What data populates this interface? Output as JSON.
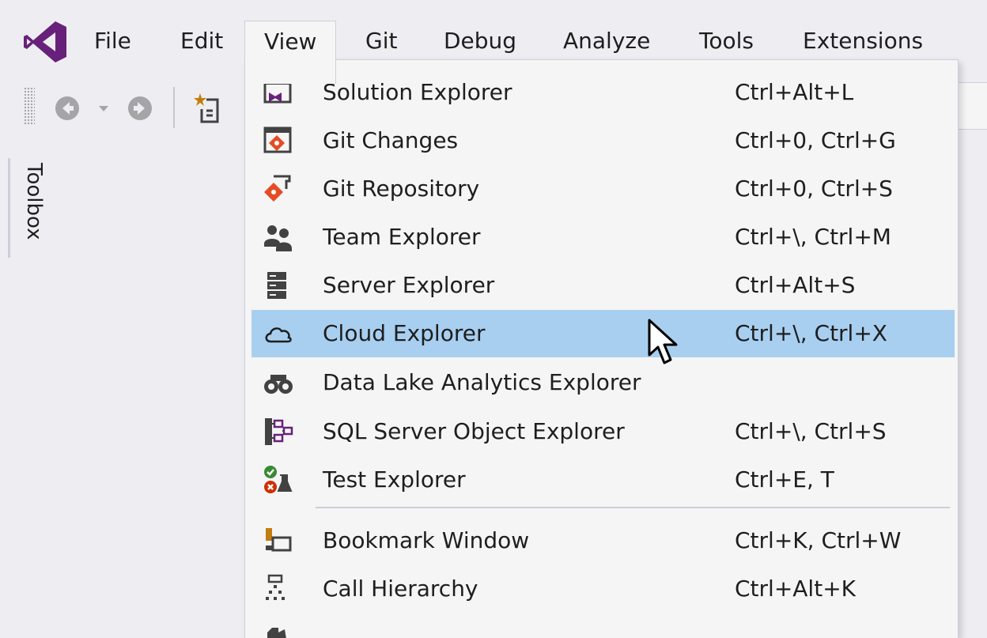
{
  "app": {
    "logo_icon": "visual-studio-logo-icon",
    "brand_color": "#68217a"
  },
  "menubar": {
    "items": [
      {
        "label": "File"
      },
      {
        "label": "Edit"
      },
      {
        "label": "View"
      },
      {
        "label": "Git"
      },
      {
        "label": "Debug"
      },
      {
        "label": "Analyze"
      },
      {
        "label": "Tools"
      },
      {
        "label": "Extensions"
      }
    ],
    "open_menu": "View"
  },
  "toolbar": {
    "icons": [
      "navigate-back-icon",
      "back-dropdown-icon",
      "navigate-forward-icon",
      "new-project-icon"
    ]
  },
  "toolbox": {
    "label": "Toolbox"
  },
  "view_menu": {
    "items": [
      {
        "label": "Solution Explorer",
        "shortcut": "Ctrl+Alt+L",
        "icon": "solution-explorer-icon"
      },
      {
        "label": "Git Changes",
        "shortcut": "Ctrl+0, Ctrl+G",
        "icon": "git-changes-icon"
      },
      {
        "label": "Git Repository",
        "shortcut": "Ctrl+0, Ctrl+S",
        "icon": "git-repository-icon"
      },
      {
        "label": "Team Explorer",
        "shortcut": "Ctrl+\\, Ctrl+M",
        "icon": "team-explorer-icon"
      },
      {
        "label": "Server Explorer",
        "shortcut": "Ctrl+Alt+S",
        "icon": "server-explorer-icon"
      },
      {
        "label": "Cloud Explorer",
        "shortcut": "Ctrl+\\, Ctrl+X",
        "icon": "cloud-icon",
        "highlighted": true
      },
      {
        "label": "Data Lake Analytics Explorer",
        "shortcut": "",
        "icon": "binoculars-icon"
      },
      {
        "label": "SQL Server Object Explorer",
        "shortcut": "Ctrl+\\, Ctrl+S",
        "icon": "sql-object-explorer-icon"
      },
      {
        "label": "Test Explorer",
        "shortcut": "Ctrl+E, T",
        "icon": "test-explorer-icon"
      },
      {
        "label": "Bookmark Window",
        "shortcut": "Ctrl+K, Ctrl+W",
        "icon": "bookmark-window-icon"
      },
      {
        "label": "Call Hierarchy",
        "shortcut": "Ctrl+Alt+K",
        "icon": "call-hierarchy-icon"
      }
    ],
    "highlight_color": "#a8cff0"
  }
}
